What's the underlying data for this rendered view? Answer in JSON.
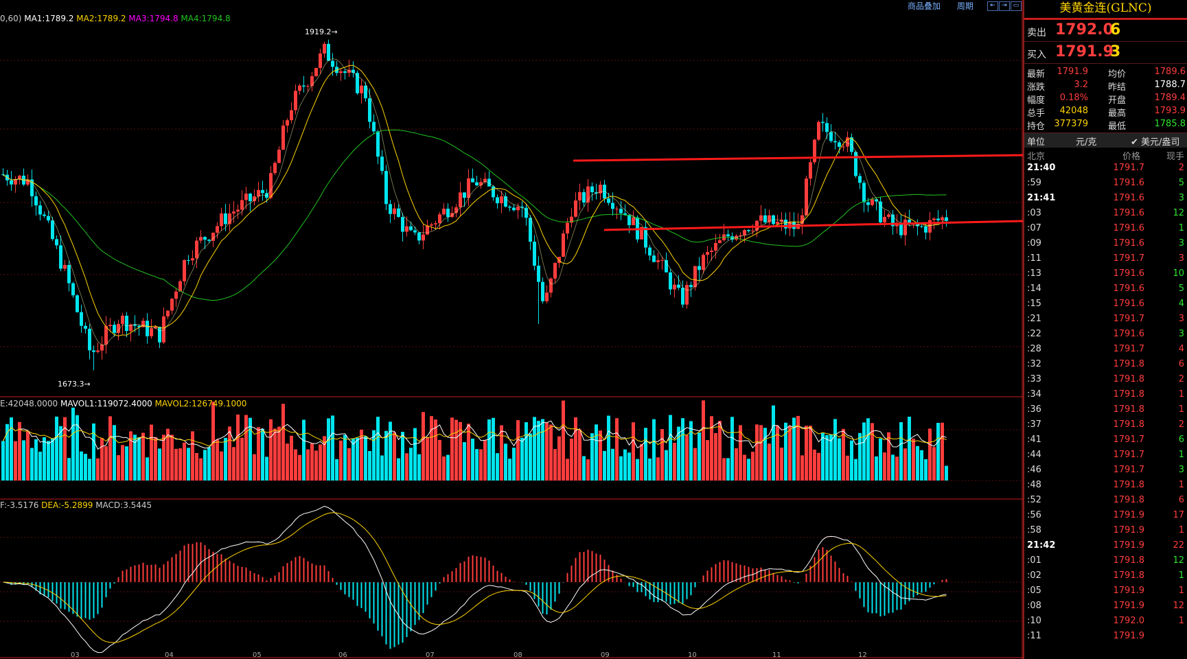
{
  "toolbar": {
    "overlay_label": "商品叠加",
    "period_label": "周期"
  },
  "price_indicators": {
    "prefix": "0,60)",
    "ma1": "MA1:1789.2",
    "ma2": "MA2:1789.2",
    "ma3": "MA3:1794.8",
    "ma4": "MA4:1794.8",
    "high_marker": "1919.2",
    "low_marker": "1673.3"
  },
  "volume_indicators": {
    "vol": "E:42048.0000",
    "mavol1": "MAVOL1:119072.4000",
    "mavol2": "MAVOL2:126749.1000"
  },
  "macd_indicators": {
    "diff": "F:-3.5176",
    "dea": "DEA:-5.2899",
    "macd": "MACD:3.5445"
  },
  "x_axis_labels": [
    "03",
    "04",
    "05",
    "06",
    "07",
    "08",
    "09",
    "10",
    "11",
    "12"
  ],
  "colors": {
    "up": "#ff3d3d",
    "down": "#00e5ee",
    "ma1": "#ffffff",
    "ma2": "#ffd400",
    "ma3": "#ff00ff",
    "ma4": "#21c521"
  },
  "panel": {
    "title": "美黄金连(GLNC)",
    "sell_label": "卖出",
    "sell_price": "1792.0",
    "sell_qty": "6",
    "buy_label": "买入",
    "buy_price": "1791.9",
    "buy_qty": "3",
    "stats": [
      {
        "k1": "最新",
        "v1": "1791.9",
        "c1": "red",
        "k2": "均价",
        "v2": "1789.6",
        "c2": "red"
      },
      {
        "k1": "涨跌",
        "v1": "3.2",
        "c1": "red",
        "k2": "昨结",
        "v2": "1788.7",
        "c2": "white"
      },
      {
        "k1": "幅度",
        "v1": "0.18%",
        "c1": "red",
        "k2": "开盘",
        "v2": "1789.4",
        "c2": "red"
      },
      {
        "k1": "总手",
        "v1": "42048",
        "c1": "yel",
        "k2": "最高",
        "v2": "1793.9",
        "c2": "red"
      },
      {
        "k1": "持仓",
        "v1": "377379",
        "c1": "yel",
        "k2": "最低",
        "v2": "1785.8",
        "c2": "grn"
      }
    ],
    "unit_label": "单位",
    "unit_cny": "元/克",
    "unit_usd": "✔ 美元/盎司",
    "table_headers": {
      "time": "北京",
      "price": "价格",
      "qty": "现手"
    },
    "ticks": [
      {
        "t": "21:40",
        "p": "1791.7",
        "n": "2",
        "c": "red",
        "full": true
      },
      {
        "t": ":59",
        "p": "1791.6",
        "n": "5",
        "c": "grn"
      },
      {
        "t": "21:41",
        "p": "1791.6",
        "n": "3",
        "c": "grn",
        "full": true
      },
      {
        "t": ":03",
        "p": "1791.6",
        "n": "12",
        "c": "grn"
      },
      {
        "t": ":07",
        "p": "1791.6",
        "n": "1",
        "c": "grn"
      },
      {
        "t": ":09",
        "p": "1791.6",
        "n": "3",
        "c": "grn"
      },
      {
        "t": ":11",
        "p": "1791.7",
        "n": "3",
        "c": "red"
      },
      {
        "t": ":13",
        "p": "1791.6",
        "n": "10",
        "c": "grn"
      },
      {
        "t": ":14",
        "p": "1791.6",
        "n": "5",
        "c": "grn"
      },
      {
        "t": ":15",
        "p": "1791.6",
        "n": "4",
        "c": "grn"
      },
      {
        "t": ":21",
        "p": "1791.7",
        "n": "3",
        "c": "red"
      },
      {
        "t": ":22",
        "p": "1791.6",
        "n": "3",
        "c": "grn"
      },
      {
        "t": ":28",
        "p": "1791.7",
        "n": "4",
        "c": "red"
      },
      {
        "t": ":32",
        "p": "1791.8",
        "n": "6",
        "c": "red"
      },
      {
        "t": ":33",
        "p": "1791.8",
        "n": "2",
        "c": "red"
      },
      {
        "t": ":34",
        "p": "1791.8",
        "n": "1",
        "c": "red"
      },
      {
        "t": ":36",
        "p": "1791.8",
        "n": "1",
        "c": "red"
      },
      {
        "t": ":37",
        "p": "1791.8",
        "n": "2",
        "c": "red"
      },
      {
        "t": ":41",
        "p": "1791.7",
        "n": "6",
        "c": "grn"
      },
      {
        "t": ":44",
        "p": "1791.7",
        "n": "1",
        "c": "grn"
      },
      {
        "t": ":46",
        "p": "1791.7",
        "n": "3",
        "c": "grn"
      },
      {
        "t": ":48",
        "p": "1791.8",
        "n": "1",
        "c": "red"
      },
      {
        "t": ":52",
        "p": "1791.8",
        "n": "6",
        "c": "red"
      },
      {
        "t": ":56",
        "p": "1791.9",
        "n": "17",
        "c": "red"
      },
      {
        "t": ":58",
        "p": "1791.9",
        "n": "1",
        "c": "red"
      },
      {
        "t": "21:42",
        "p": "1791.9",
        "n": "22",
        "c": "red",
        "full": true
      },
      {
        "t": ":01",
        "p": "1791.8",
        "n": "12",
        "c": "grn"
      },
      {
        "t": ":02",
        "p": "1791.8",
        "n": "1",
        "c": "grn"
      },
      {
        "t": ":05",
        "p": "1791.9",
        "n": "1",
        "c": "red"
      },
      {
        "t": ":08",
        "p": "1791.9",
        "n": "12",
        "c": "red"
      },
      {
        "t": ":10",
        "p": "1792.0",
        "n": "1",
        "c": "red"
      },
      {
        "t": ":11",
        "p": "1791.9",
        "n": "",
        "c": "red"
      }
    ]
  }
}
